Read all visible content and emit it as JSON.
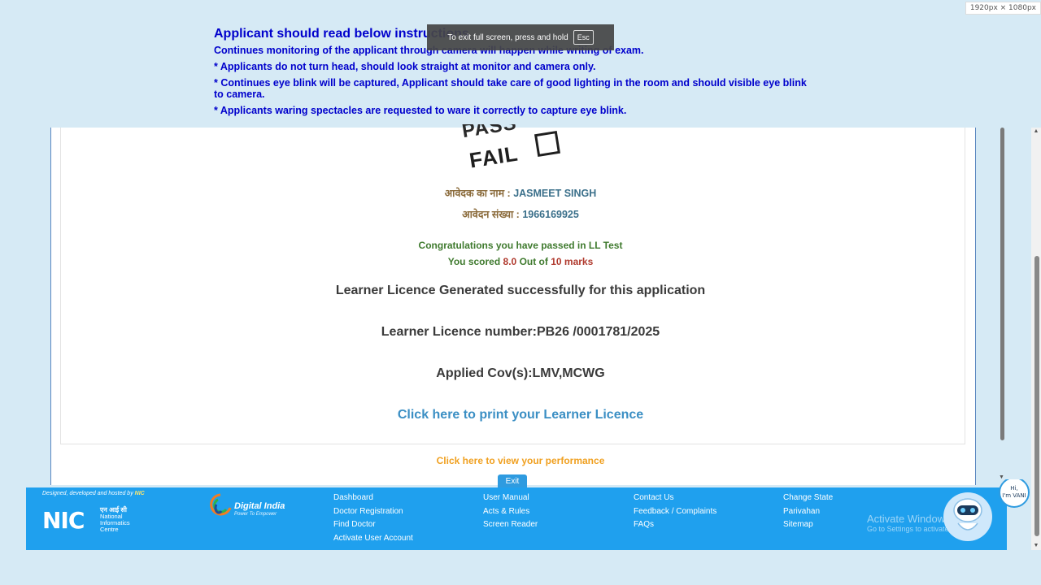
{
  "screen_resolution": "1920px × 1080px",
  "instructions": {
    "title": "Applicant should read below instructions",
    "items": [
      "Continues monitoring of the applicant through camera will happen while writing of exam.",
      "* Applicants do not turn head, should look straight at monitor and camera only.",
      "* Continues eye blink will be captured, Applicant should take care of good lighting in the room and should visible eye blink to camera.",
      "* Applicants waring spectacles are requested to ware it correctly to capture eye blink."
    ]
  },
  "fullscreen_notice": {
    "text": "To exit full screen, press and hold",
    "key": "Esc"
  },
  "result_stamp": {
    "pass": "PASS",
    "fail": "FAIL"
  },
  "applicant": {
    "name_label": "आवेदक का नाम :",
    "name_value": "JASMEET SINGH",
    "app_no_label": "आवेदन संख्या :",
    "app_no_value": "1966169925"
  },
  "result": {
    "congrats": "Congratulations you have passed in LL Test",
    "score_prefix": "You scored",
    "score_value": "8.0",
    "score_mid": "Out of",
    "score_total": "10 marks"
  },
  "licence": {
    "generated": "Learner Licence Generated successfully for this application",
    "number": "Learner Licence number:PB26 /0001781/2025",
    "cov": "Applied Cov(s):LMV,MCWG",
    "print_link": "Click here to print your Learner Licence",
    "performance_link": "Click here to view your performance",
    "exit_button": "Exit"
  },
  "footer": {
    "designed_by": "Designed, developed and hosted by",
    "designed_by_org": "NIC",
    "nic_logo": {
      "mark": "NIC",
      "hindi": "एन आई सी",
      "english": "National Informatics Centre"
    },
    "digital_india": {
      "title": "Digital India",
      "tagline": "Power To Empower"
    },
    "col1": [
      "Dashboard",
      "Doctor Registration",
      "Find Doctor",
      "Activate User Account"
    ],
    "col2": [
      "User Manual",
      "Acts & Rules",
      "Screen Reader"
    ],
    "col3": [
      "Contact Us",
      "Feedback / Complaints",
      "FAQs"
    ],
    "col4": [
      "Change State",
      "Parivahan",
      "Sitemap"
    ],
    "activate_windows": {
      "title": "Activate Windows",
      "subtitle": "Go to Settings to activate Windows."
    }
  },
  "vani": {
    "greeting": "Hi,",
    "name": "I'm VANI"
  },
  "colors": {
    "instruction_blue": "#0000cc",
    "footer_blue": "#1fa0ee",
    "print_link": "#3b8fc4",
    "performance_link": "#f0a020",
    "pass_green": "#3f7a2e"
  }
}
